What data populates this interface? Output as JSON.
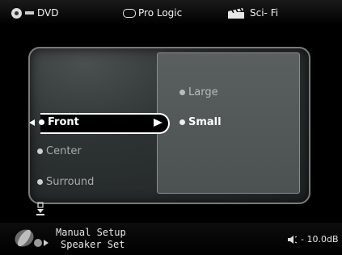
{
  "topbar": {
    "source": "DVD",
    "audio_mode": "Pro Logic",
    "genre": "Sci- Fi"
  },
  "menu": {
    "items": [
      {
        "label": "Front",
        "selected": true
      },
      {
        "label": "Center",
        "selected": false
      },
      {
        "label": "Surround",
        "selected": false
      }
    ],
    "options": [
      {
        "label": "Large",
        "selected": false
      },
      {
        "label": "Small",
        "selected": true
      }
    ]
  },
  "bottombar": {
    "line1": "Manual Setup",
    "line2": "Speaker Set",
    "volume": "- 10.0dB"
  },
  "colors": {
    "panel_bg": "#2d3232",
    "subpanel_bg": "#555a5a",
    "highlight": "#ffffff",
    "dim_text": "#a8abab"
  },
  "icons": [
    "disc-icon",
    "dolby-icon",
    "clapperboard-icon",
    "setup-icon",
    "speaker-icon",
    "down-marker-icon",
    "left-arrow-icon",
    "right-arrow-icon"
  ]
}
